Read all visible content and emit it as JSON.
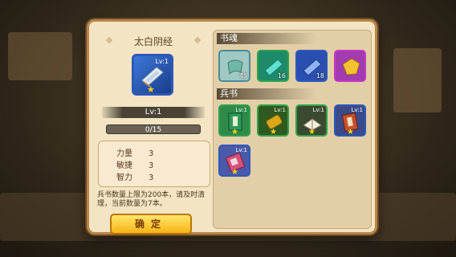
{
  "dialog": {
    "book_title": "太白阴经",
    "book_slot": {
      "level": "Lv:1",
      "rarity_color": "#2d58b8",
      "icon": "book-scroll-icon"
    },
    "level_label": "Lv:1",
    "exp_text": "0/15",
    "stats": [
      {
        "name": "力量",
        "value": "3"
      },
      {
        "name": "敏捷",
        "value": "3"
      },
      {
        "name": "智力",
        "value": "3"
      }
    ],
    "note": "兵书数量上限为200本，请及时清理，当前数量为7本。",
    "confirm_label": "确定"
  },
  "right": {
    "soul_section": "书魂",
    "soul_items": [
      {
        "icon": "green-cloth-icon",
        "count": "45",
        "border": "#4b8a9a",
        "bg": "#9fc9c2"
      },
      {
        "icon": "teal-scroll-icon",
        "count": "16",
        "border": "#2fa24a",
        "bg": "#1f8a6a"
      },
      {
        "icon": "blue-scroll-icon",
        "count": "18",
        "border": "#2d58b8",
        "bg": "#2a4fb0"
      },
      {
        "icon": "gold-scroll-icon",
        "count": "",
        "border": "#c03ac0",
        "bg": "#a23ab0"
      }
    ],
    "book_section": "兵书",
    "book_items": [
      {
        "icon": "green-book-icon",
        "level": "Lv:1",
        "border": "#2fa24a",
        "bg": "#2f8a4a"
      },
      {
        "icon": "bamboo-scroll-icon",
        "level": "Lv:1",
        "border": "#2fa24a",
        "bg": "#2e5a20"
      },
      {
        "icon": "white-book-icon",
        "level": "Lv:1",
        "border": "#2fa24a",
        "bg": "#3a4a30"
      },
      {
        "icon": "red-book-icon",
        "level": "Lv:1",
        "border": "#2d58b8",
        "bg": "#3a4a8a"
      },
      {
        "icon": "pink-book-icon",
        "level": "Lv:1",
        "border": "#2d58b8",
        "bg": "#4a5aa8"
      }
    ]
  }
}
